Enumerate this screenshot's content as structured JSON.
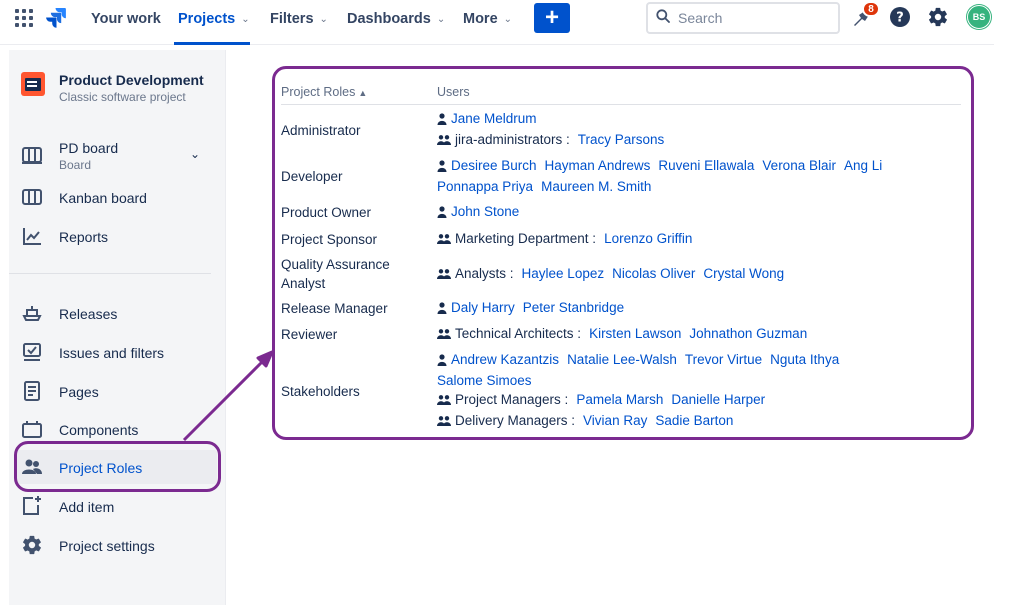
{
  "nav": {
    "your_work": "Your work",
    "projects": "Projects",
    "filters": "Filters",
    "dashboards": "Dashboards",
    "more": "More",
    "create": "+",
    "search_placeholder": "Search",
    "notifications_count": "8",
    "avatar_initials": "BS",
    "accent": "#0052cc"
  },
  "sidebar": {
    "project_name": "Product Development",
    "project_type": "Classic software project",
    "items": [
      {
        "label": "PD board",
        "sub": "Board",
        "icon": "board-icon"
      },
      {
        "label": "Kanban board",
        "icon": "kanban-icon"
      },
      {
        "label": "Reports",
        "icon": "reports-icon"
      },
      {
        "label": "Releases",
        "icon": "ship-icon"
      },
      {
        "label": "Issues and filters",
        "icon": "issues-icon"
      },
      {
        "label": "Pages",
        "icon": "page-icon"
      },
      {
        "label": "Components",
        "icon": "components-icon"
      },
      {
        "label": "Project Roles",
        "icon": "people-icon",
        "selected": true
      },
      {
        "label": "Add item",
        "icon": "add-item-icon"
      },
      {
        "label": "Project settings",
        "icon": "gear-icon"
      }
    ]
  },
  "roles_table": {
    "headers": {
      "role": "Project Roles",
      "users": "Users"
    },
    "rows": [
      {
        "role": "Administrator",
        "lines": [
          {
            "type": "user",
            "items": [
              "Jane Meldrum"
            ]
          },
          {
            "type": "group",
            "group": "jira-administrators :",
            "items": [
              "Tracy Parsons"
            ]
          }
        ]
      },
      {
        "role": "Developer",
        "lines": [
          {
            "type": "user",
            "items": [
              "Desiree Burch",
              "Hayman Andrews",
              "Ruveni Ellawala",
              "Verona Blair",
              "Ang Li"
            ]
          },
          {
            "type": "cont",
            "items": [
              "Ponnappa Priya",
              "Maureen M. Smith"
            ]
          }
        ]
      },
      {
        "role": "Product Owner",
        "lines": [
          {
            "type": "user",
            "items": [
              "John Stone"
            ]
          }
        ]
      },
      {
        "role": "Project Sponsor",
        "lines": [
          {
            "type": "group",
            "group": "Marketing Department :",
            "items": [
              "Lorenzo Griffin"
            ]
          }
        ]
      },
      {
        "role": "Quality Assurance Analyst",
        "lines": [
          {
            "type": "group",
            "group": "Analysts :",
            "items": [
              "Haylee Lopez",
              "Nicolas Oliver",
              "Crystal Wong"
            ]
          }
        ]
      },
      {
        "role": "Release Manager",
        "lines": [
          {
            "type": "user",
            "items": [
              "Daly Harry",
              "Peter Stanbridge"
            ]
          }
        ]
      },
      {
        "role": "Reviewer",
        "lines": [
          {
            "type": "group",
            "group": "Technical Architects :",
            "items": [
              "Kirsten Lawson",
              "Johnathon Guzman"
            ]
          }
        ]
      },
      {
        "role": "Stakeholders",
        "lines": [
          {
            "type": "user",
            "items": [
              "Andrew Kazantzis",
              "Natalie Lee-Walsh",
              "Trevor Virtue",
              "Nguta Ithya"
            ]
          },
          {
            "type": "cont",
            "items": [
              "Salome Simoes"
            ]
          },
          {
            "type": "group",
            "group": "Project Managers :",
            "items": [
              "Pamela Marsh",
              "Danielle Harper"
            ]
          },
          {
            "type": "group",
            "group": "Delivery Managers :",
            "items": [
              "Vivian Ray",
              "Sadie Barton"
            ]
          }
        ]
      }
    ]
  },
  "annotation_color": "#7b2a90"
}
